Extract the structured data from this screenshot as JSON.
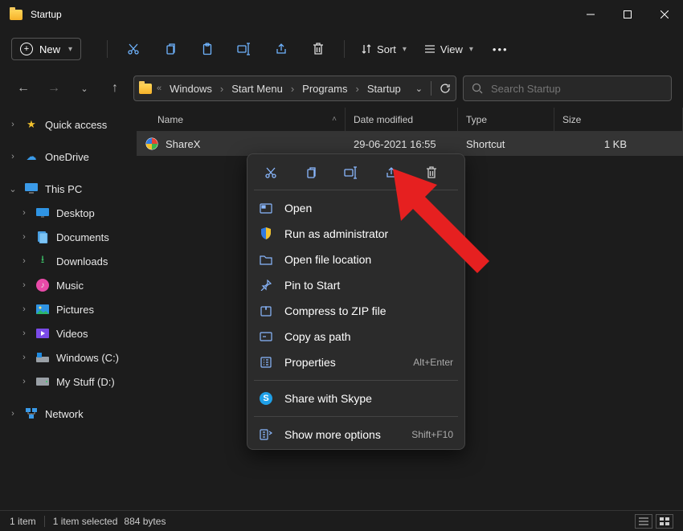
{
  "title": "Startup",
  "toolbar": {
    "new_label": "New",
    "sort_label": "Sort",
    "view_label": "View"
  },
  "breadcrumbs": [
    "Windows",
    "Start Menu",
    "Programs",
    "Startup"
  ],
  "search": {
    "placeholder": "Search Startup"
  },
  "columns": {
    "name": "Name",
    "date": "Date modified",
    "type": "Type",
    "size": "Size"
  },
  "rows": [
    {
      "name": "ShareX",
      "date": "29-06-2021 16:55",
      "type": "Shortcut",
      "size": "1 KB"
    }
  ],
  "sidebar": {
    "quick_access": "Quick access",
    "onedrive": "OneDrive",
    "thispc": "This PC",
    "desktop": "Desktop",
    "documents": "Documents",
    "downloads": "Downloads",
    "music": "Music",
    "pictures": "Pictures",
    "videos": "Videos",
    "windows_c": "Windows (C:)",
    "mystuff_d": "My Stuff (D:)",
    "network": "Network"
  },
  "context_menu": {
    "open": "Open",
    "runadmin": "Run as administrator",
    "openloc": "Open file location",
    "pin": "Pin to Start",
    "zip": "Compress to ZIP file",
    "copypath": "Copy as path",
    "properties": "Properties",
    "properties_short": "Alt+Enter",
    "skype": "Share with Skype",
    "more": "Show more options",
    "more_short": "Shift+F10"
  },
  "status": {
    "count": "1 item",
    "selected": "1 item selected",
    "bytes": "884 bytes"
  }
}
